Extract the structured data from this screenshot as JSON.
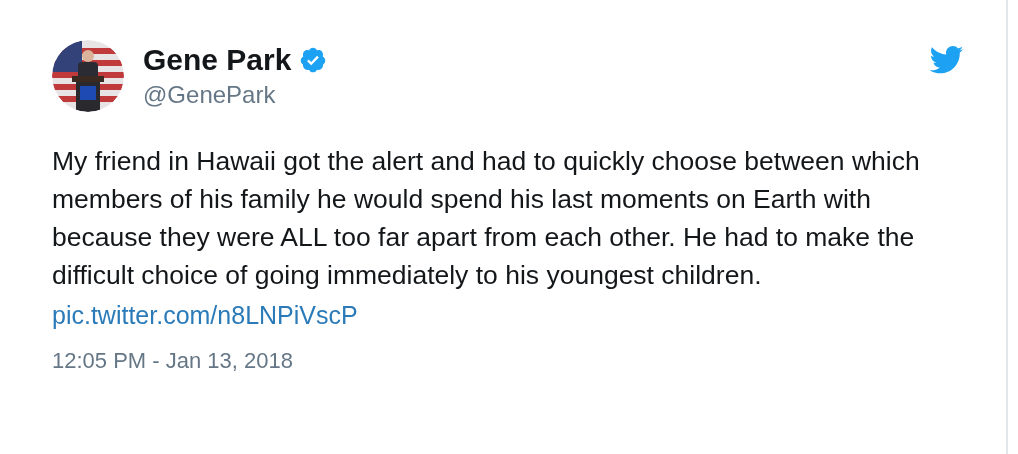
{
  "author": {
    "name": "Gene Park",
    "verified": true,
    "handle": "@GenePark"
  },
  "tweet": {
    "text": "My friend in Hawaii got the alert and had to quickly choose between which members of his family he would spend his last moments on Earth with because they were ALL too far apart from each other. He had to make the difficult choice of going immediately to his youngest children.",
    "link": "pic.twitter.com/n8LNPiVscP",
    "timestamp": "12:05 PM - Jan 13, 2018"
  }
}
